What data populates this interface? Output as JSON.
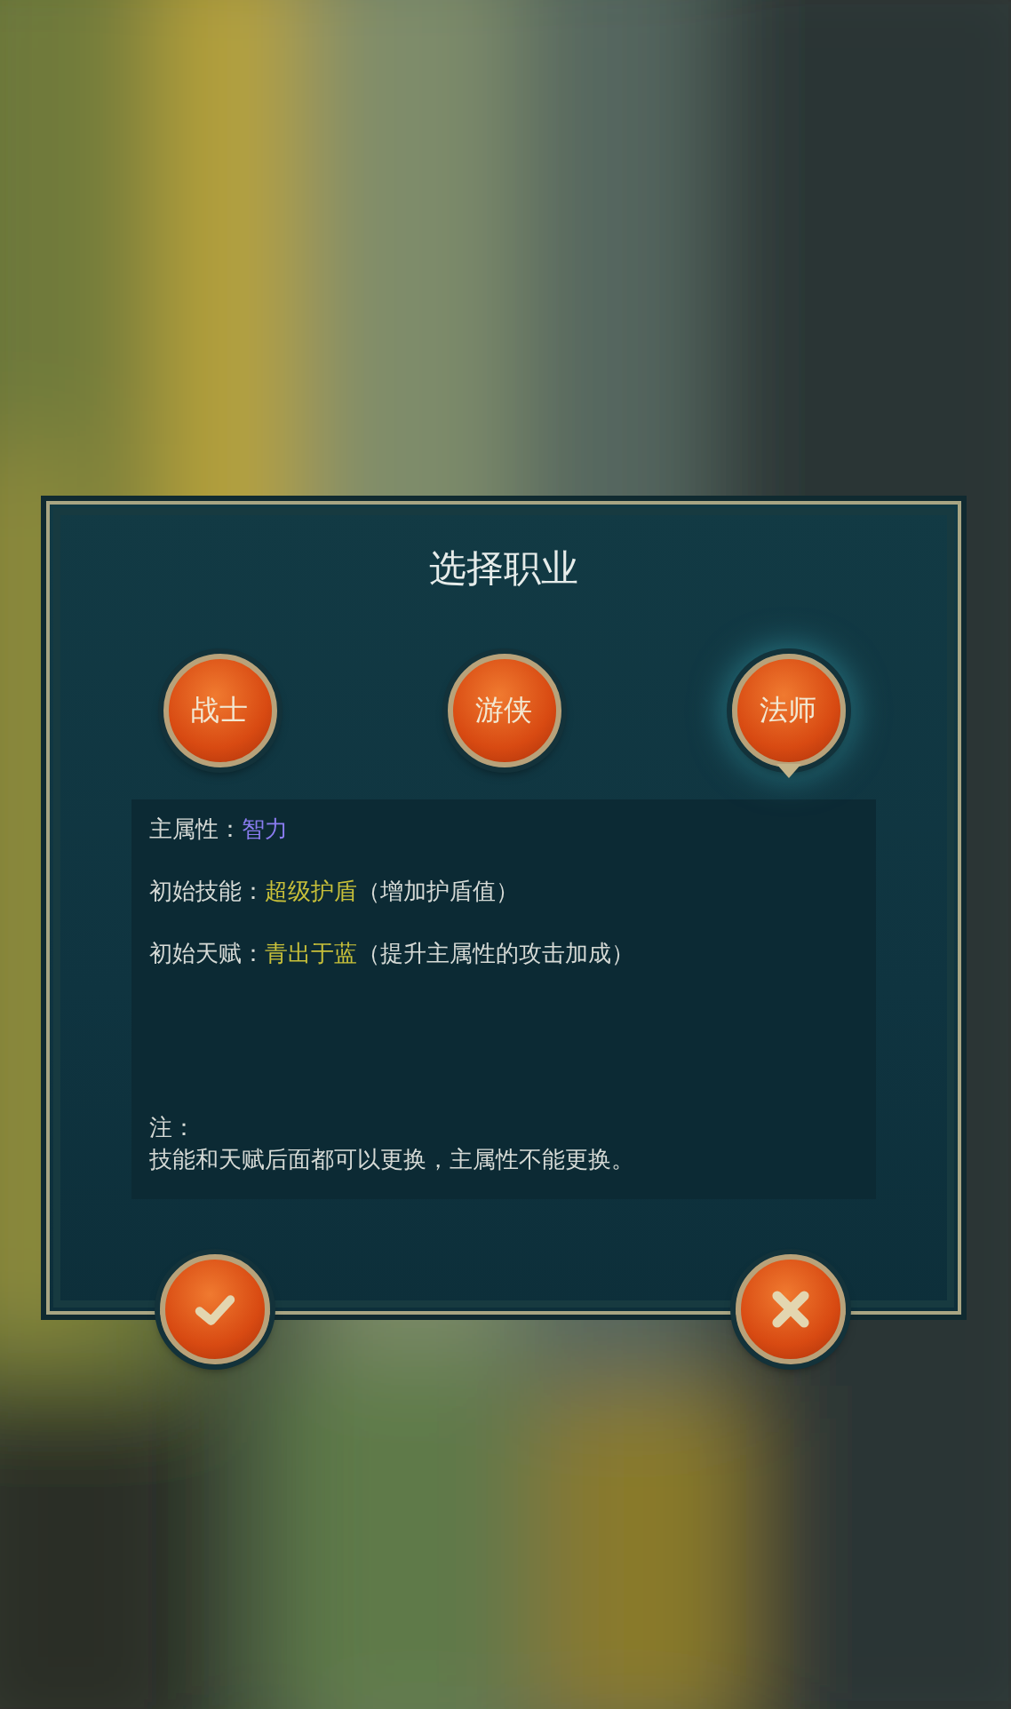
{
  "dialog": {
    "title": "选择职业"
  },
  "classes": [
    {
      "label": "战士",
      "selected": false
    },
    {
      "label": "游侠",
      "selected": false
    },
    {
      "label": "法师",
      "selected": true
    }
  ],
  "info": [
    {
      "label": "主属性：",
      "value": "智力",
      "color": "#8a7cf0"
    },
    {
      "label": "初始技能：",
      "value": "超级护盾",
      "detail": "（增加护盾值）",
      "color": "#c8c03a"
    },
    {
      "label": "初始天赋：",
      "value": "青出于蓝",
      "detail": "（提升主属性的攻击加成）",
      "color": "#c8c03a"
    }
  ],
  "note": {
    "heading": "注：",
    "text": "技能和天赋后面都可以更换，主属性不能更换。"
  },
  "actions": [
    {
      "kind": "confirm"
    },
    {
      "kind": "cancel"
    }
  ]
}
